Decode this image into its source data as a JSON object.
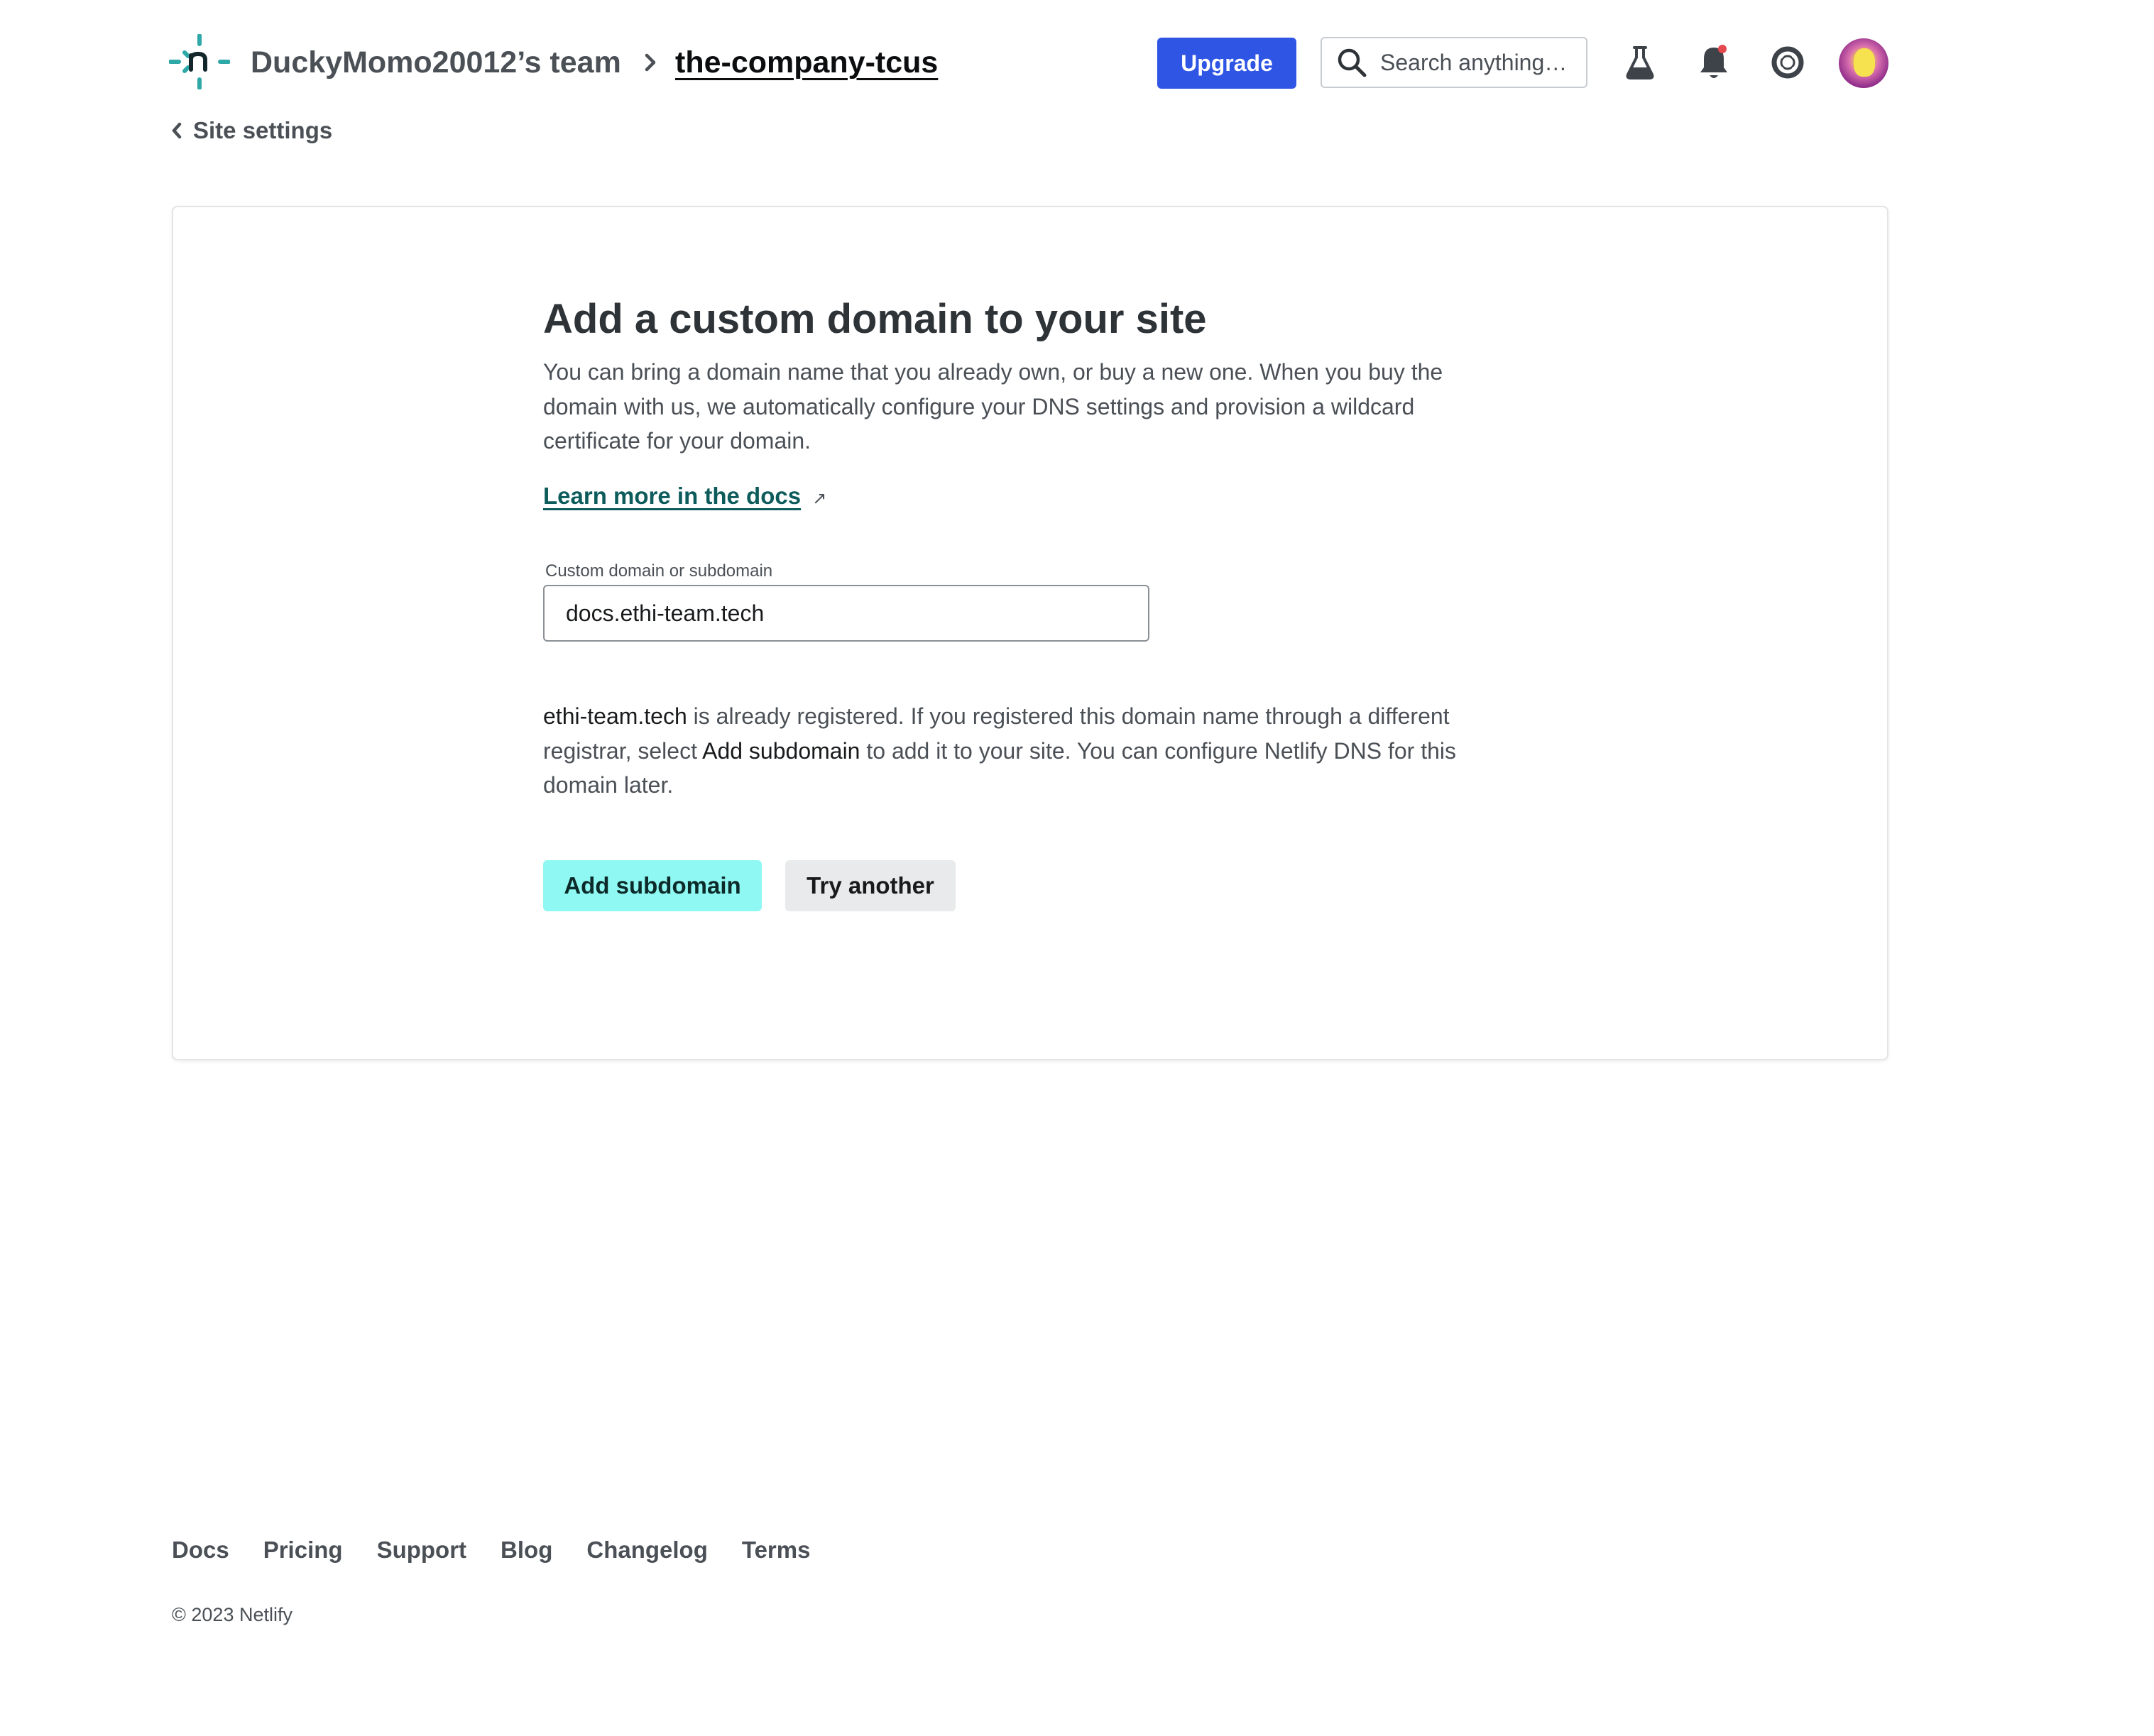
{
  "header": {
    "team_name": "DuckyMomo20012’s team",
    "site_name": "the-company-tcus",
    "upgrade_label": "Upgrade",
    "search_placeholder": "Search anything…",
    "icons": [
      "netlify-logo-icon",
      "chevron-right-icon",
      "search-icon",
      "flask-icon",
      "bell-icon",
      "help-lifebuoy-icon",
      "avatar"
    ],
    "colors": {
      "upgrade_bg": "#2f55e4",
      "logo_teal": "#2ea9a8",
      "notification_dot": "#e5484d"
    }
  },
  "nav": {
    "back_label": "Site settings"
  },
  "main": {
    "title": "Add a custom domain to your site",
    "description": "You can bring a domain name that you already own, or buy a new one. When you buy the domain with us, we automatically configure your DNS settings and provision a wildcard certificate for your domain.",
    "docs_link_label": "Learn more in the docs",
    "docs_link_icon": "↗",
    "field_label": "Custom domain or subdomain",
    "field_value": "docs.ethi-team.tech",
    "note": {
      "domain": "ethi-team.tech",
      "part1": " is already registered. If you registered this domain name through a different registrar, select ",
      "action": "Add subdomain",
      "part2": " to add it to your site. You can configure Netlify DNS for this domain later."
    },
    "primary_button": "Add subdomain",
    "secondary_button": "Try another",
    "colors": {
      "primary_button_bg": "#8ff8f2",
      "link": "#0d5b5b"
    }
  },
  "footer": {
    "links": [
      "Docs",
      "Pricing",
      "Support",
      "Blog",
      "Changelog",
      "Terms"
    ],
    "copyright": "© 2023 Netlify"
  }
}
